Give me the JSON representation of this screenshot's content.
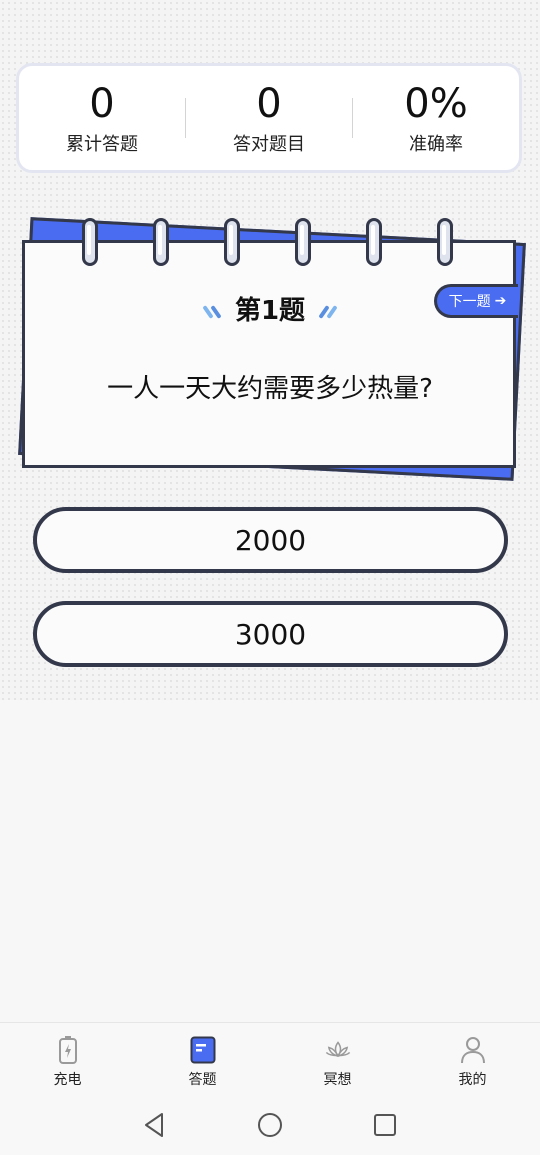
{
  "stats": [
    {
      "value": "0",
      "label": "累计答题"
    },
    {
      "value": "0",
      "label": "答对题目"
    },
    {
      "value": "0%",
      "label": "准确率"
    }
  ],
  "question": {
    "title": "第1题",
    "text": "一人一天大约需要多少热量?",
    "next_label": "下一题"
  },
  "options": [
    "2000",
    "3000"
  ],
  "tabs": [
    {
      "label": "充电",
      "icon": "battery-charge-icon"
    },
    {
      "label": "答题",
      "icon": "quiz-book-icon",
      "active": true
    },
    {
      "label": "冥想",
      "icon": "lotus-icon"
    },
    {
      "label": "我的",
      "icon": "person-icon"
    }
  ],
  "colors": {
    "accent": "#4a6cf0",
    "outline": "#33384a"
  }
}
